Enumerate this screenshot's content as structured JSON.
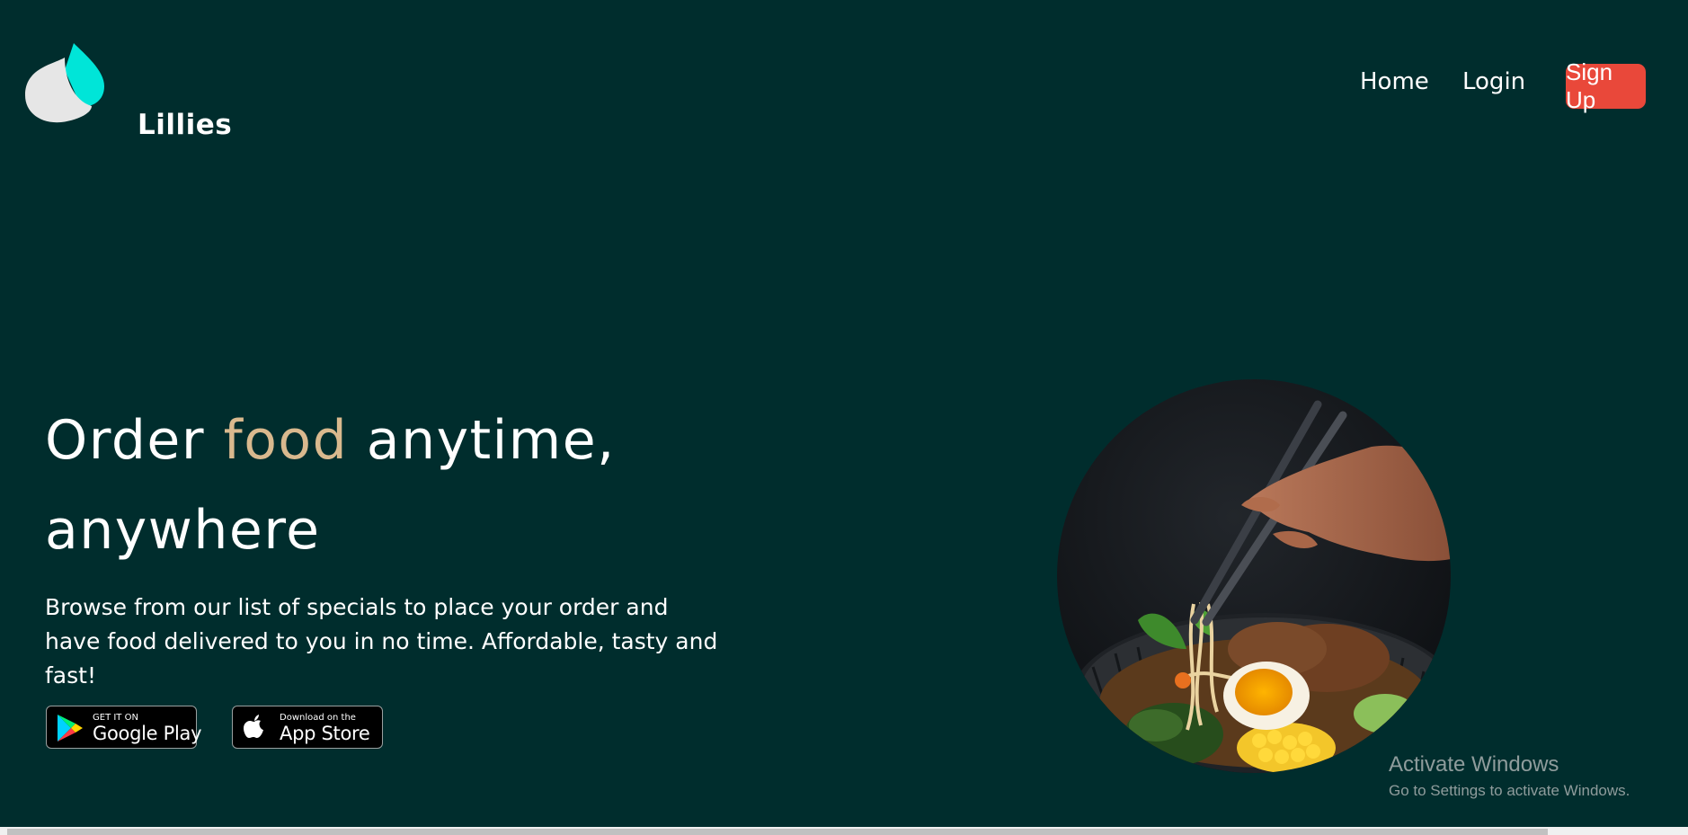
{
  "brand": {
    "name": "Lillies"
  },
  "nav": {
    "home": "Home",
    "login": "Login",
    "signup": "Sign Up"
  },
  "hero": {
    "title_part1": "Order ",
    "title_accent": "food",
    "title_part2": " anytime,",
    "title_line2": "anywhere",
    "description": "Browse from our list of specials to place your order and have food delivered to you in no time. Affordable, tasty and fast!"
  },
  "stores": {
    "google": {
      "small": "GET IT ON",
      "big": "Google Play"
    },
    "apple": {
      "small": "Download on the",
      "big": "App Store"
    }
  },
  "watermark": {
    "title": "Activate Windows",
    "subtitle": "Go to Settings to activate Windows."
  },
  "colors": {
    "background": "#002d2d",
    "accent": "#d9b98e",
    "signup": "#e9483a",
    "logo_teal": "#00e5d8"
  }
}
